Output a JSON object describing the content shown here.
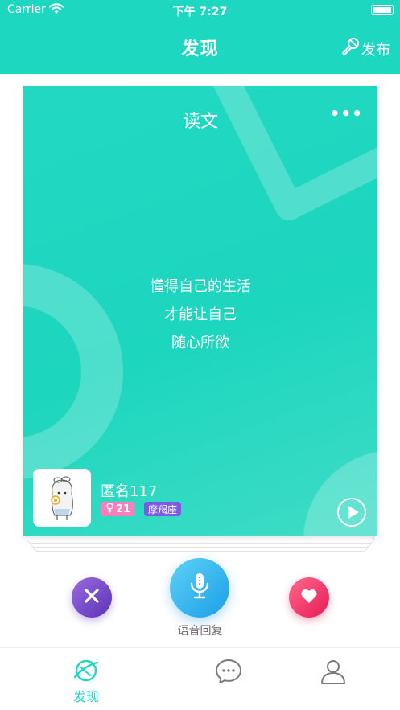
{
  "status_bar": {
    "carrier": "Carrier",
    "time": "下午 7:27"
  },
  "header": {
    "title": "发现",
    "publish_label": "发布"
  },
  "card": {
    "title": "读文",
    "more_label": "•••",
    "lines": [
      "懂得自己的生活",
      "才能让自己",
      "随心所欲"
    ],
    "author": "匿名117",
    "age": "21",
    "zodiac": "摩羯座"
  },
  "actions": {
    "voice_reply_label": "语音回复"
  },
  "tabbar": {
    "discover_label": "发现"
  },
  "colors": {
    "accent": "#1dd7c1",
    "dislike": "#6b3fc4",
    "voice": "#2aa8ec",
    "like": "#f0265f",
    "age_badge": "#f77fbd",
    "zodiac_badge": "#7c5ae6"
  },
  "icons": {
    "publish": "microphone-icon",
    "more": "more-dots-icon",
    "dislike": "close-icon",
    "voice": "microphone-icon",
    "like": "heart-icon",
    "play": "play-icon",
    "discover_tab": "planet-icon",
    "messages_tab": "chat-bubble-icon",
    "profile_tab": "user-icon",
    "age_badge": "female-symbol-icon"
  }
}
